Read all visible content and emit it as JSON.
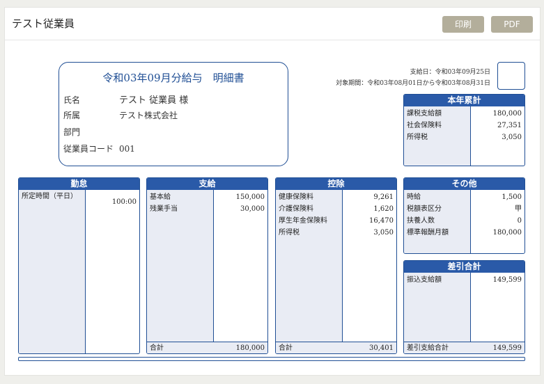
{
  "header": {
    "title": "テスト従業員",
    "print_label": "印刷",
    "pdf_label": "PDF"
  },
  "slip": {
    "title": "令和03年09月分給与　明細書",
    "name_label": "氏名",
    "name_value": "テスト 従業員 様",
    "affiliation_label": "所属",
    "affiliation_value": "テスト株式会社",
    "department_label": "部門",
    "department_value": "",
    "code_label": "従業員コード",
    "code_value": "001"
  },
  "dates": {
    "pay_date": "支給日：令和03年09月25日",
    "period": "対象期間：令和03年08月01日から令和03年08月31日"
  },
  "ytd": {
    "title": "本年累計",
    "rows": [
      {
        "label": "課税支給額",
        "value": "180,000"
      },
      {
        "label": "社会保険料",
        "value": "27,351"
      },
      {
        "label": "所得税",
        "value": "3,050"
      }
    ]
  },
  "attendance": {
    "title": "勤怠",
    "rows": [
      {
        "label": "所定時間（平日）",
        "value": "100:00"
      }
    ]
  },
  "payments": {
    "title": "支給",
    "rows": [
      {
        "label": "基本給",
        "value": "150,000"
      },
      {
        "label": "残業手当",
        "value": "30,000"
      }
    ],
    "total_label": "合計",
    "total_value": "180,000"
  },
  "deductions": {
    "title": "控除",
    "rows": [
      {
        "label": "健康保険料",
        "value": "9,261"
      },
      {
        "label": "介護保険料",
        "value": "1,620"
      },
      {
        "label": "厚生年金保険料",
        "value": "16,470"
      },
      {
        "label": "所得税",
        "value": "3,050"
      }
    ],
    "total_label": "合計",
    "total_value": "30,401"
  },
  "other": {
    "title": "その他",
    "rows": [
      {
        "label": "時給",
        "value": "1,500"
      },
      {
        "label": "税額表区分",
        "value": "甲"
      },
      {
        "label": "扶養人数",
        "value": "0"
      },
      {
        "label": "標準報酬月額",
        "value": "180,000"
      }
    ]
  },
  "net": {
    "title": "差引合計",
    "rows": [
      {
        "label": "振込支給額",
        "value": "149,599"
      }
    ],
    "total_label": "差引支給合計",
    "total_value": "149,599"
  },
  "colors": {
    "accent": "#2a5aa8",
    "border": "#1f4e94",
    "button": "#b3ae9b",
    "column_fill": "#e9ecf4"
  }
}
